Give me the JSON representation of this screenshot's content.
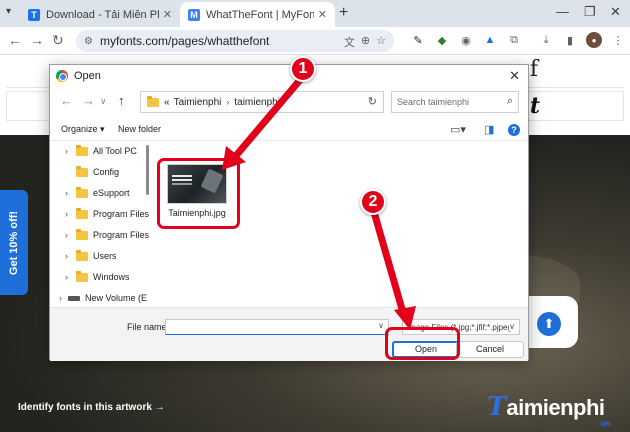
{
  "browser": {
    "tabs": [
      {
        "title": "Download - Tải Miễn Phí VN - P",
        "favicon": "T",
        "favicon_color": "#1a73e8",
        "active": false
      },
      {
        "title": "WhatTheFont | MyFonts' AI-Pow",
        "favicon": "M",
        "favicon_color": "#3b82f6",
        "active": true
      }
    ],
    "new_tab_icon": "plus-icon",
    "address": "myfonts.com/pages/whatthefont"
  },
  "page": {
    "side_tab": "Get 10% off!",
    "identify_link": "Identify fonts in this artwork",
    "identify_arrow": "→",
    "logo": {
      "first": "T",
      "rest": "aimienphi",
      "suffix": ".vn"
    }
  },
  "dialog": {
    "title": "Open",
    "breadcrumb": [
      "«",
      "Taimienphi",
      "taimienphi"
    ],
    "search_placeholder": "Search taimienphi",
    "organize": "Organize ▾",
    "new_folder": "New folder",
    "nav_items": [
      {
        "label": "All Tool PC",
        "type": "folder",
        "expandable": true
      },
      {
        "label": "Config",
        "type": "folder",
        "expandable": false
      },
      {
        "label": "eSupport",
        "type": "folder",
        "expandable": true
      },
      {
        "label": "Program Files",
        "type": "folder",
        "expandable": true
      },
      {
        "label": "Program Files",
        "type": "folder",
        "expandable": true
      },
      {
        "label": "Users",
        "type": "folder",
        "expandable": true
      },
      {
        "label": "Windows",
        "type": "folder",
        "expandable": true
      },
      {
        "label": "New Volume (E",
        "type": "drive",
        "expandable": true
      }
    ],
    "file": {
      "name": "Taimienphi.jpg"
    },
    "file_name_label": "File name:",
    "file_name_value": "",
    "filter": "Image Files (*.jpg;*.jfif;*.pjpeg",
    "open_button": "Open",
    "cancel_button": "Cancel"
  },
  "annotations": {
    "step1": "1",
    "step2": "2",
    "color": "#e3001b"
  }
}
